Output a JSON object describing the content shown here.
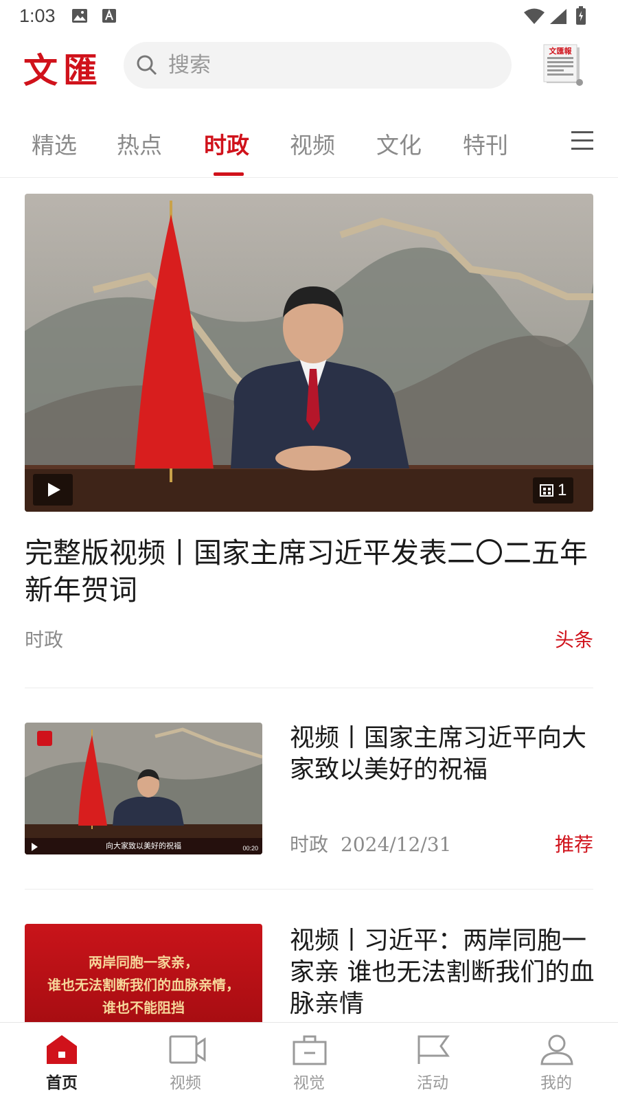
{
  "status_bar": {
    "time": "1:03"
  },
  "header": {
    "logo_text": "文匯",
    "search_placeholder": "搜索",
    "paper_icon_text": "文匯報"
  },
  "tabs": [
    {
      "label": "精选",
      "active": false
    },
    {
      "label": "热点",
      "active": false
    },
    {
      "label": "时政",
      "active": true
    },
    {
      "label": "视频",
      "active": false
    },
    {
      "label": "文化",
      "active": false
    },
    {
      "label": "特刊",
      "active": false
    }
  ],
  "hero": {
    "title": "完整版视频丨国家主席习近平发表二〇二五年新年贺词",
    "category": "时政",
    "tag": "头条",
    "image_count": "1"
  },
  "items": [
    {
      "title": "视频丨国家主席习近平向大家致以美好的祝福",
      "category": "时政",
      "date": "2024/12/31",
      "tag": "推荐",
      "thumb_caption": "向大家致以美好的祝福",
      "thumb_duration": "00:20"
    },
    {
      "title": "视频丨习近平：两岸同胞一家亲 谁也无法割断我们的血脉亲情",
      "thumb_lines": [
        "两岸同胞一家亲，",
        "谁也无法割断我们的血脉亲情，",
        "谁也不能阻挡"
      ]
    }
  ],
  "bottom_nav": [
    {
      "label": "首页",
      "icon": "home-icon",
      "active": true
    },
    {
      "label": "视频",
      "icon": "video-icon",
      "active": false
    },
    {
      "label": "视觉",
      "icon": "briefcase-icon",
      "active": false
    },
    {
      "label": "活动",
      "icon": "flag-icon",
      "active": false
    },
    {
      "label": "我的",
      "icon": "user-icon",
      "active": false
    }
  ],
  "colors": {
    "accent": "#d0121b",
    "muted": "#8a8a8a"
  }
}
